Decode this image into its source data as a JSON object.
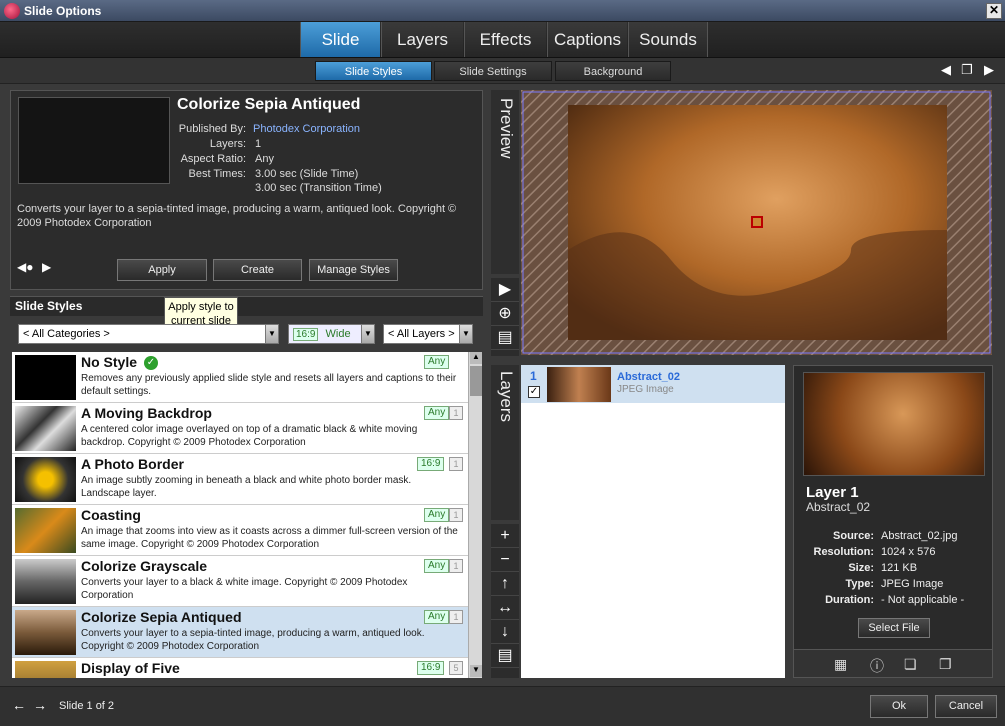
{
  "window": {
    "title": "Slide Options"
  },
  "main_tabs": [
    "Slide",
    "Layers",
    "Effects",
    "Captions",
    "Sounds"
  ],
  "sub_tabs": [
    "Slide Styles",
    "Slide Settings",
    "Background"
  ],
  "style_info": {
    "title": "Colorize Sepia Antiqued",
    "published_by_label": "Published By:",
    "published_by": "Photodex Corporation",
    "layers_label": "Layers:",
    "layers": "1",
    "aspect_label": "Aspect Ratio:",
    "aspect": "Any",
    "best_times_label": "Best Times:",
    "best_time_slide": "3.00 sec (Slide Time)",
    "best_time_transition": "3.00 sec (Transition Time)",
    "description": "Converts your layer to a sepia-tinted image, producing a warm, antiqued look. Copyright © 2009 Photodex Corporation"
  },
  "actions": {
    "apply": "Apply",
    "create": "Create",
    "manage": "Manage Styles"
  },
  "tooltip": "Apply style to current slide",
  "styles_section": {
    "title": "Slide Styles"
  },
  "filters": {
    "category": "< All Categories >",
    "aspect_badge": "16:9",
    "aspect": "Wide",
    "layers": "< All Layers >"
  },
  "styles": [
    {
      "name": "No Style",
      "desc": "Removes any previously applied slide style and resets all layers and captions to their default settings.",
      "badge": "Any",
      "num": "",
      "check": true
    },
    {
      "name": "A Moving Backdrop",
      "desc": "A centered color image overlayed on top of a dramatic black & white moving backdrop. Copyright © 2009 Photodex Corporation",
      "badge": "Any",
      "num": "1"
    },
    {
      "name": "A Photo Border",
      "desc": "An image subtly zooming in beneath a black and white photo border mask. Landscape layer.",
      "badge": "16:9",
      "num": "1"
    },
    {
      "name": "Coasting",
      "desc": "An image that zooms into view as it coasts across a dimmer full-screen version of the same image.  Copyright © 2009 Photodex Corporation",
      "badge": "Any",
      "num": "1"
    },
    {
      "name": "Colorize Grayscale",
      "desc": "Converts your layer to a black & white image.  Copyright © 2009 Photodex Corporation",
      "badge": "Any",
      "num": "1"
    },
    {
      "name": "Colorize Sepia Antiqued",
      "desc": "Converts your layer to a sepia-tinted image, producing a warm, antiqued look. Copyright © 2009 Photodex Corporation",
      "badge": "Any",
      "num": "1"
    },
    {
      "name": "Display of Five",
      "desc": "",
      "badge": "16:9",
      "num": "5"
    }
  ],
  "preview_label": "Preview",
  "layers_label": "Layers",
  "layer_item": {
    "index": "1",
    "name": "Abstract_02",
    "type": "JPEG Image"
  },
  "layer_detail": {
    "title": "Layer 1",
    "subtitle": "Abstract_02",
    "source_label": "Source:",
    "source": "Abstract_02.jpg",
    "resolution_label": "Resolution:",
    "resolution": "1024 x 576",
    "size_label": "Size:",
    "size": "121 KB",
    "type_label": "Type:",
    "type": "JPEG Image",
    "duration_label": "Duration:",
    "duration": "- Not applicable -",
    "select_file": "Select File"
  },
  "footer": {
    "slide_counter": "Slide 1 of 2",
    "ok": "Ok",
    "cancel": "Cancel"
  }
}
